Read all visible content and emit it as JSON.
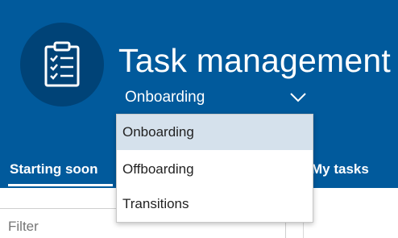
{
  "app": {
    "title": "Task management",
    "icon": "clipboard-checklist-icon"
  },
  "selector": {
    "selected": "Onboarding",
    "chevron_icon": "chevron-down-icon"
  },
  "tabs": [
    {
      "label": "Starting soon",
      "active": true
    },
    {
      "label": "My tasks",
      "active": false
    }
  ],
  "filter": {
    "placeholder": "Filter"
  },
  "dropdown": {
    "options": [
      "Onboarding",
      "Offboarding",
      "Transitions"
    ],
    "highlighted_index": 0
  },
  "colors": {
    "header_bg": "#015a9c",
    "icon_circle": "#004377",
    "highlight": "#d5e1ec"
  }
}
